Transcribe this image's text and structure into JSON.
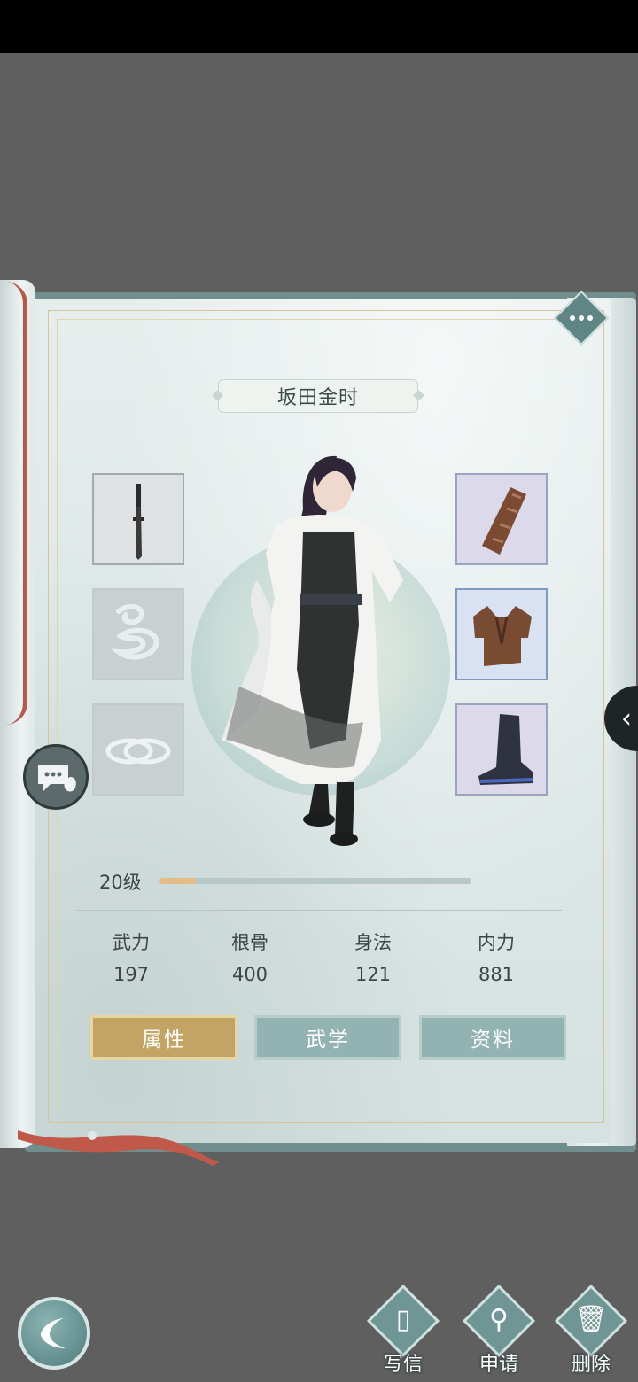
{
  "character": {
    "name": "坂田金时"
  },
  "level": {
    "text": "20级",
    "progress": 0.12
  },
  "stats": [
    {
      "label": "武力",
      "value": "197"
    },
    {
      "label": "根骨",
      "value": "400"
    },
    {
      "label": "身法",
      "value": "121"
    },
    {
      "label": "内力",
      "value": "881"
    }
  ],
  "tabs": [
    {
      "label": "属性",
      "active": true
    },
    {
      "label": "武学",
      "active": false
    },
    {
      "label": "资料",
      "active": false
    }
  ],
  "actions": [
    {
      "label": "写信",
      "icon": "letter-icon"
    },
    {
      "label": "申请",
      "icon": "add-friend-icon"
    },
    {
      "label": "删除",
      "icon": "trash-icon"
    }
  ],
  "slots_left": [
    "dagger-weapon",
    "empty-inner-art",
    "empty-ring"
  ],
  "slots_right": [
    "leather-bracer",
    "leather-armor",
    "black-boots"
  ],
  "colors": {
    "accent_gold": "#c4a464",
    "teal": "#6f9594",
    "page": "#dfe8e7"
  }
}
